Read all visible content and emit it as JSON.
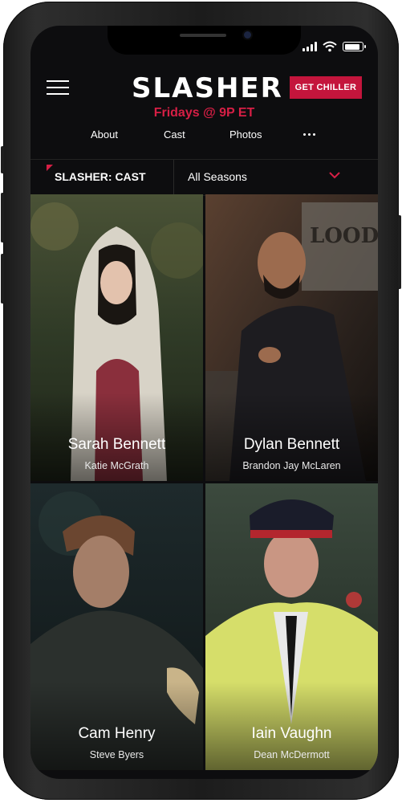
{
  "header": {
    "logo": "SLASHER",
    "cta_label": "GET CHILLER",
    "airtime": "Fridays @ 9P ET"
  },
  "nav": {
    "tabs": [
      "About",
      "Cast",
      "Photos"
    ],
    "more_icon": "more-dots-icon"
  },
  "filter": {
    "title": "SLASHER: CAST",
    "season_selected": "All Seasons",
    "dropdown_icon": "chevron-down-icon"
  },
  "cast": [
    {
      "character": "Sarah Bennett",
      "actor": "Katie McGrath"
    },
    {
      "character": "Dylan Bennett",
      "actor": "Brandon Jay McLaren"
    },
    {
      "character": "Cam Henry",
      "actor": "Steve Byers"
    },
    {
      "character": "Iain Vaughn",
      "actor": "Dean McDermott"
    }
  ],
  "colors": {
    "accent": "#c4153c",
    "airtime": "#d71f45",
    "background": "#0d0d0f"
  }
}
